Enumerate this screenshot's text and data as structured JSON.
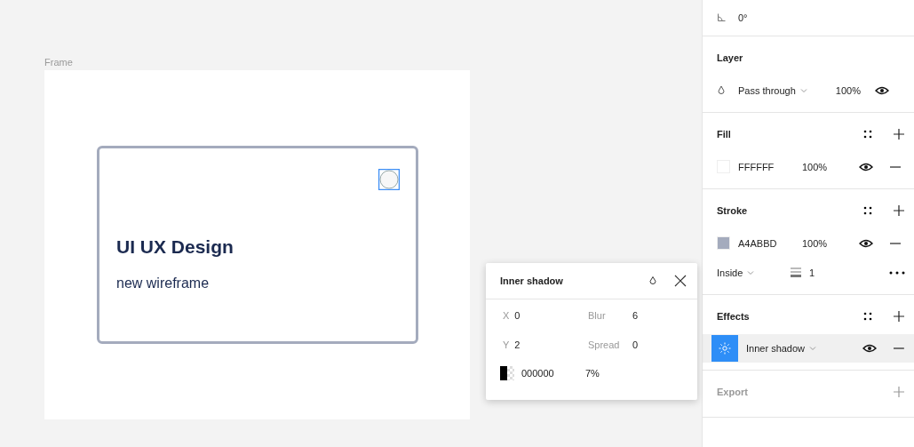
{
  "canvas": {
    "frame_label": "Frame",
    "card": {
      "title": "UI UX Design",
      "subtitle": "new wireframe"
    }
  },
  "popup": {
    "title": "Inner shadow",
    "fields": [
      {
        "label": "X",
        "value": "0"
      },
      {
        "label": "Blur",
        "value": "6"
      },
      {
        "label": "Y",
        "value": "2"
      },
      {
        "label": "Spread",
        "value": "0"
      }
    ],
    "color": {
      "hex": "000000",
      "opacity": "7%",
      "color": "#000000"
    }
  },
  "panel": {
    "rotation": "0°",
    "layer": {
      "title": "Layer",
      "blend": "Pass through",
      "opacity": "100%",
      "visible": true
    },
    "fill": {
      "title": "Fill",
      "hex": "FFFFFF",
      "opacity": "100%",
      "color": "#ffffff",
      "visible": true
    },
    "stroke": {
      "title": "Stroke",
      "hex": "A4ABBD",
      "opacity": "100%",
      "color": "#a4abbd",
      "visible": true,
      "position": "Inside",
      "weight": "1"
    },
    "effects": {
      "title": "Effects",
      "items": [
        {
          "label": "Inner shadow",
          "selected": true,
          "visible": true
        }
      ]
    },
    "export": {
      "title": "Export"
    }
  }
}
